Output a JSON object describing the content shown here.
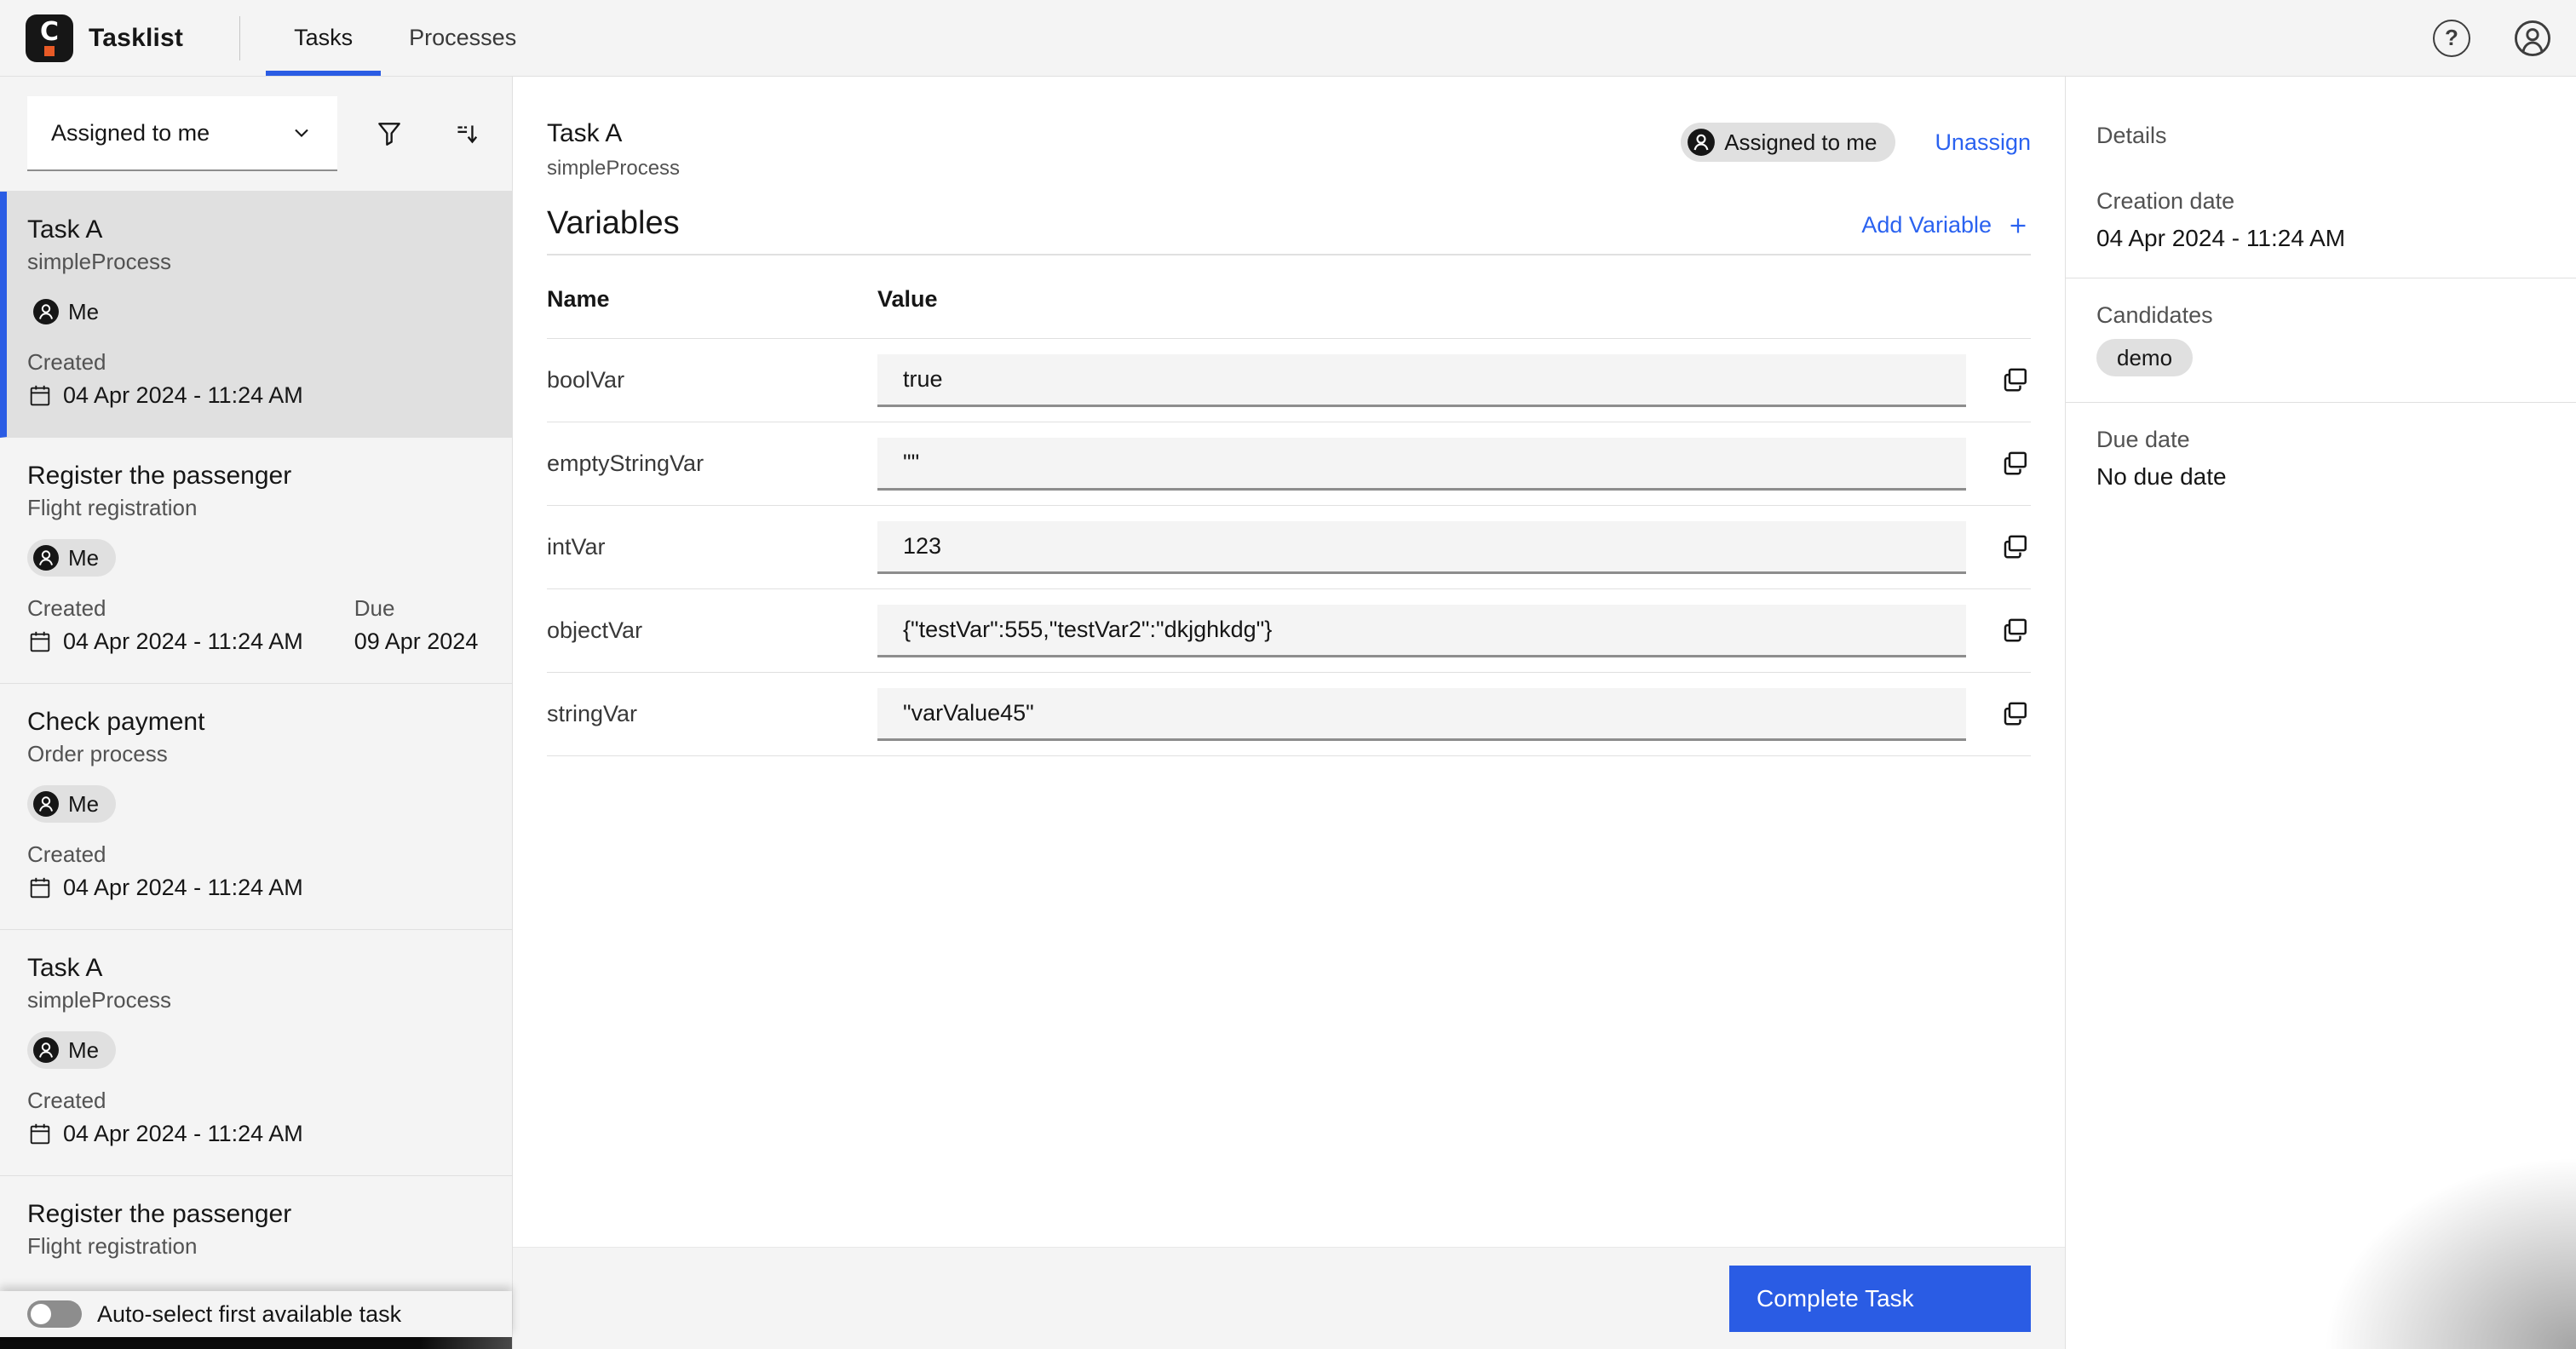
{
  "header": {
    "app_title": "Tasklist",
    "tabs": [
      {
        "label": "Tasks",
        "active": true
      },
      {
        "label": "Processes",
        "active": false
      }
    ],
    "help_glyph": "?"
  },
  "sidebar": {
    "filter_dropdown_value": "Assigned to me",
    "tasks": [
      {
        "title": "Task A",
        "process": "simpleProcess",
        "assignee": "Me",
        "created_label": "Created",
        "created": "04 Apr 2024 - 11:24 AM",
        "selected": true
      },
      {
        "title": "Register the passenger",
        "process": "Flight registration",
        "assignee": "Me",
        "created_label": "Created",
        "created": "04 Apr 2024 - 11:24 AM",
        "due_label": "Due",
        "due": "09 Apr 2024"
      },
      {
        "title": "Check payment",
        "process": "Order process",
        "assignee": "Me",
        "created_label": "Created",
        "created": "04 Apr 2024 - 11:24 AM"
      },
      {
        "title": "Task A",
        "process": "simpleProcess",
        "assignee": "Me",
        "created_label": "Created",
        "created": "04 Apr 2024 - 11:24 AM"
      },
      {
        "title": "Register the passenger",
        "process": "Flight registration"
      }
    ],
    "autoselect_label": "Auto-select first available task",
    "autoselect_on": false
  },
  "task_detail": {
    "title": "Task A",
    "process": "simpleProcess",
    "assigned_badge": "Assigned to me",
    "unassign_label": "Unassign",
    "variables_title": "Variables",
    "add_variable_label": "Add Variable",
    "table": {
      "name_header": "Name",
      "value_header": "Value",
      "rows": [
        {
          "name": "boolVar",
          "value": "true"
        },
        {
          "name": "emptyStringVar",
          "value": "\"\""
        },
        {
          "name": "intVar",
          "value": "123"
        },
        {
          "name": "objectVar",
          "value": "{\"testVar\":555,\"testVar2\":\"dkjghkdg\"}"
        },
        {
          "name": "stringVar",
          "value": "\"varValue45\""
        }
      ]
    },
    "complete_button_label": "Complete Task"
  },
  "details_panel": {
    "title": "Details",
    "creation_date_label": "Creation date",
    "creation_date": "04 Apr 2024 - 11:24 AM",
    "candidates_label": "Candidates",
    "candidates": [
      "demo"
    ],
    "due_date_label": "Due date",
    "due_date": "No due date"
  },
  "colors": {
    "accent_blue": "#2a5ce4",
    "link_blue": "#2a62f0",
    "panel_bg": "#f4f4f4",
    "selected_bg": "#e0e0e0",
    "logo_bg": "#161616",
    "logo_accent": "#e85a26",
    "text_primary": "#161616",
    "text_secondary": "#525252"
  }
}
